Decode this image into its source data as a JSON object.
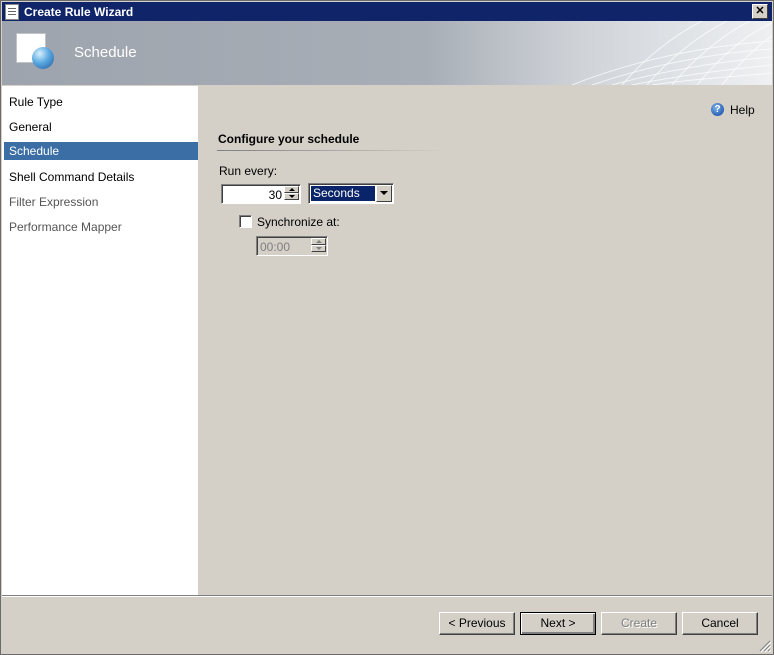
{
  "window": {
    "title": "Create Rule Wizard",
    "close_glyph": "✕"
  },
  "banner": {
    "title": "Schedule"
  },
  "sidebar": {
    "items": [
      {
        "label": "Rule Type"
      },
      {
        "label": "General"
      },
      {
        "label": "Schedule"
      },
      {
        "label": "Shell Command Details"
      },
      {
        "label": "Filter Expression"
      },
      {
        "label": "Performance Mapper"
      }
    ]
  },
  "help": {
    "label": "Help",
    "glyph": "?"
  },
  "schedule": {
    "section_title": "Configure your schedule",
    "run_every_label": "Run every:",
    "interval_value": "30",
    "unit_value": "Seconds",
    "sync_label": "Synchronize at:",
    "sync_checked": false,
    "sync_time": "00:00"
  },
  "buttons": {
    "previous": "< Previous",
    "next": "Next >",
    "create": "Create",
    "cancel": "Cancel"
  },
  "colors": {
    "title_bar": "#10246a",
    "selection": "#3a6ea5",
    "dialog_bg": "#d4d0c8"
  }
}
